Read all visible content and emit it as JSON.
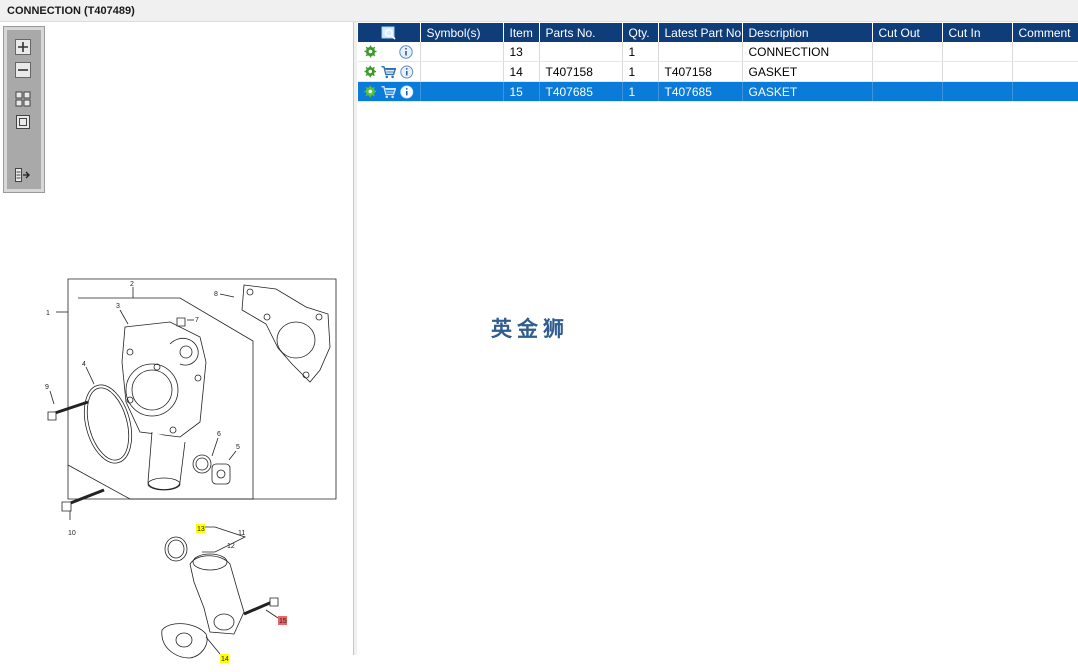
{
  "window": {
    "title": "CONNECTION (T407489)"
  },
  "toolbox": {
    "icons": [
      "zoom-in-icon",
      "zoom-out-icon",
      "fit-all-icon",
      "fit-page-icon",
      "expand-panel-icon"
    ]
  },
  "diagram": {
    "callouts": [
      "1",
      "2",
      "3",
      "4",
      "5",
      "6",
      "7",
      "8",
      "9",
      "10",
      "11",
      "12",
      "13",
      "14",
      "15"
    ],
    "highlight_colors": {
      "yellow": "#ffff00",
      "red": "#ee6666"
    }
  },
  "table": {
    "headers": {
      "icon": "",
      "symbols": "Symbol(s)",
      "item": "Item",
      "parts_no": "Parts No.",
      "qty": "Qty.",
      "latest": "Latest Part No.",
      "description": "Description",
      "cut_out": "Cut Out",
      "cut_in": "Cut In",
      "comment": "Comment"
    },
    "rows": [
      {
        "item": "13",
        "parts_no": "",
        "qty": "1",
        "latest": "",
        "description": "CONNECTION",
        "cut_out": "",
        "cut_in": "",
        "comment": "",
        "has_cart": false,
        "selected": false
      },
      {
        "item": "14",
        "parts_no": "T407158",
        "qty": "1",
        "latest": "T407158",
        "description": "GASKET",
        "cut_out": "",
        "cut_in": "",
        "comment": "",
        "has_cart": true,
        "selected": false
      },
      {
        "item": "15",
        "parts_no": "T407685",
        "qty": "1",
        "latest": "T407685",
        "description": "GASKET",
        "cut_out": "",
        "cut_in": "",
        "comment": "",
        "has_cart": true,
        "selected": true
      }
    ]
  },
  "watermark": {
    "text": "英金狮"
  },
  "colors": {
    "header_bg": "#0f3d7a",
    "selection": "#0a7bd9",
    "watermark": "#2f5d8f"
  }
}
